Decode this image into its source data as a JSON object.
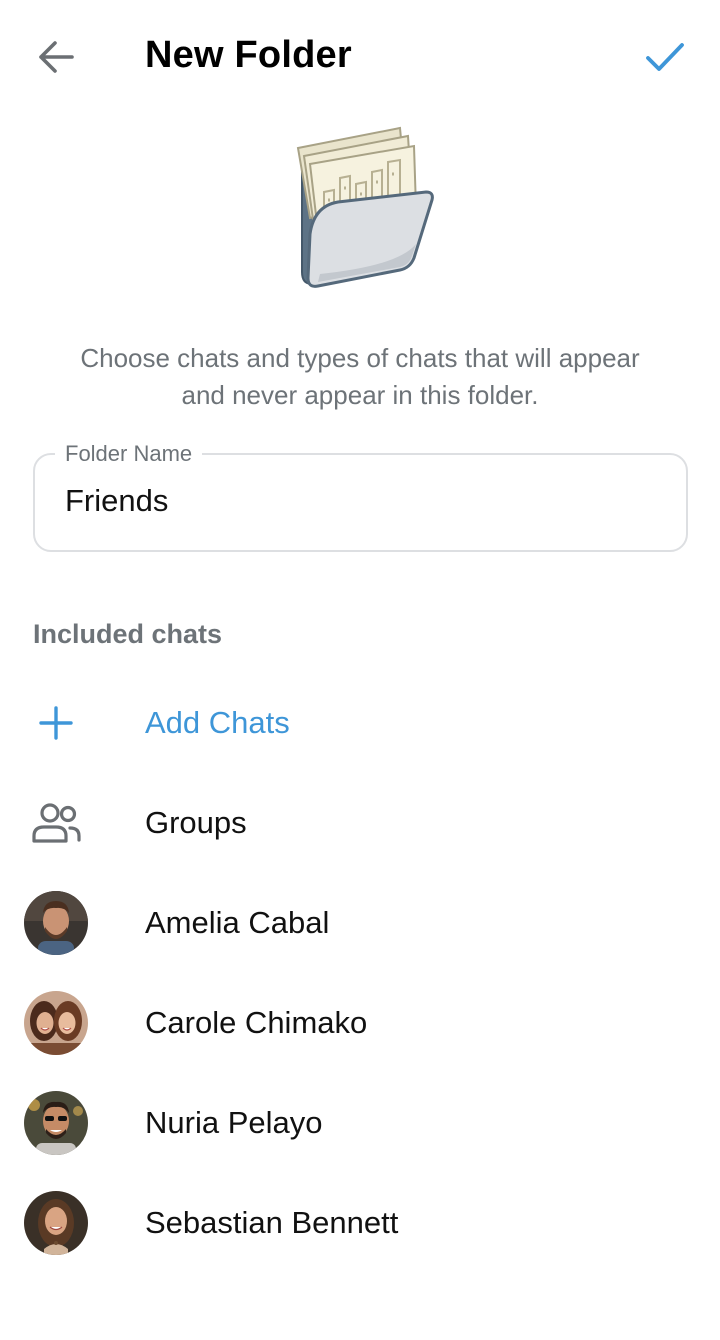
{
  "header": {
    "title": "New Folder",
    "back_icon": "arrow-left-icon",
    "done_icon": "checkmark-icon"
  },
  "illustration": {
    "icon": "folder-with-documents-icon"
  },
  "description": "Choose chats and types of chats that will appear and never appear in this folder.",
  "folder_name": {
    "label": "Folder Name",
    "value": "Friends"
  },
  "included": {
    "header": "Included chats",
    "add_label": "Add Chats",
    "items": [
      {
        "label": "Groups",
        "icon": "people-icon"
      },
      {
        "label": "Amelia Cabal",
        "icon": "avatar"
      },
      {
        "label": "Carole Chimako",
        "icon": "avatar"
      },
      {
        "label": "Nuria Pelayo",
        "icon": "avatar"
      },
      {
        "label": "Sebastian Bennett",
        "icon": "avatar"
      }
    ]
  },
  "colors": {
    "accent": "#3e96d8",
    "secondary_text": "#6d7378",
    "border": "#dddfe2"
  }
}
